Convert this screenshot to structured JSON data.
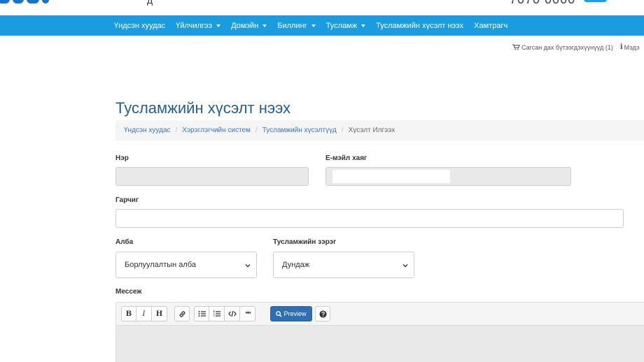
{
  "header": {
    "phone_fragment": "7070 0000",
    "small_fragment": "д"
  },
  "nav": {
    "items": [
      {
        "label": "Үндсэн хуудас",
        "dropdown": false
      },
      {
        "label": "Үйлчилгээ",
        "dropdown": true
      },
      {
        "label": "Домэйн",
        "dropdown": true
      },
      {
        "label": "Биллинг",
        "dropdown": true
      },
      {
        "label": "Тусламж",
        "dropdown": true
      },
      {
        "label": "Тусламжийн хүсэлт нээх",
        "dropdown": false
      },
      {
        "label": "Хамтрагч",
        "dropdown": false
      }
    ]
  },
  "subbar": {
    "cart_label": "Сагсан дах бүтээгдэхүүнүүд (1)",
    "info_label": "Мэдэ"
  },
  "page": {
    "title": "Тусламжийн хүсэлт нээх"
  },
  "breadcrumb": {
    "items": [
      "Үндсэн хуудас",
      "Хэрэглэгчийн систем",
      "Тусламжийн хүсэлтүүд"
    ],
    "active": "Хүсэлт Илгээх"
  },
  "form": {
    "name_label": "Нэр",
    "name_value": "",
    "email_label": "Е-мэйл хаяг",
    "email_value": "",
    "subject_label": "Гарчиг",
    "subject_value": "",
    "department_label": "Алба",
    "department_value": "Борлуулалтын алба",
    "priority_label": "Тусламжийн зэрэг",
    "priority_value": "Дундаж",
    "message_label": "Мессеж"
  },
  "editor": {
    "bold": "B",
    "italic": "I",
    "heading": "H",
    "preview_label": "Preview",
    "quote": "❝❝"
  },
  "colors": {
    "nav_bg": "#1a9de0",
    "title": "#1f5f91",
    "link": "#3178c6",
    "preview_btn": "#2e6fb0"
  }
}
